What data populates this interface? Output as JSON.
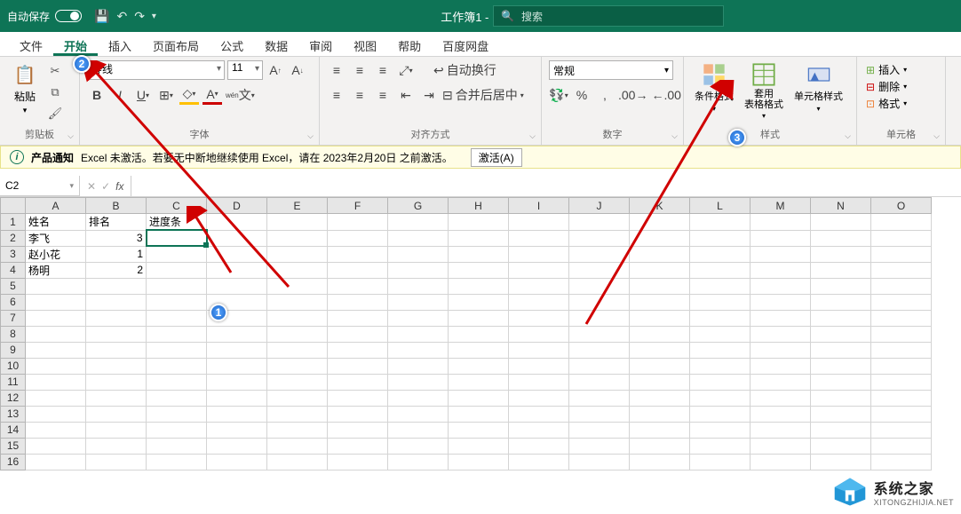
{
  "title_bar": {
    "autosave": "自动保存",
    "doc_title": "工作簿1 - Excel",
    "search_placeholder": "搜索"
  },
  "tabs": {
    "file": "文件",
    "home": "开始",
    "insert": "插入",
    "page_layout": "页面布局",
    "formulas": "公式",
    "data": "数据",
    "review": "审阅",
    "view": "视图",
    "help": "帮助",
    "baidu": "百度网盘"
  },
  "ribbon": {
    "clipboard": {
      "paste": "粘贴",
      "label": "剪贴板"
    },
    "font": {
      "name": "等线",
      "size": "11",
      "label": "字体"
    },
    "alignment": {
      "wrap": "自动换行",
      "merge": "合并后居中",
      "label": "对齐方式"
    },
    "number": {
      "format": "常规",
      "label": "数字"
    },
    "styles": {
      "conditional": "条件格式",
      "table": "套用\n表格格式",
      "cell": "单元格样式",
      "label": "样式"
    },
    "cells": {
      "insert": "插入",
      "delete": "删除",
      "format": "格式",
      "label": "单元格"
    }
  },
  "notice": {
    "title": "产品通知",
    "text": "Excel 未激活。若要无中断地继续使用 Excel，请在 2023年2月20日 之前激活。",
    "button": "激活(A)"
  },
  "namebox": {
    "ref": "C2",
    "fx": "fx"
  },
  "grid": {
    "columns": [
      "A",
      "B",
      "C",
      "D",
      "E",
      "F",
      "G",
      "H",
      "I",
      "J",
      "K",
      "L",
      "M",
      "N",
      "O"
    ],
    "rows": [
      {
        "n": 1,
        "cells": [
          "姓名",
          "排名",
          "进度条",
          "",
          "",
          "",
          "",
          "",
          "",
          "",
          "",
          "",
          "",
          "",
          ""
        ]
      },
      {
        "n": 2,
        "cells": [
          "李飞",
          "3",
          "",
          "",
          "",
          "",
          "",
          "",
          "",
          "",
          "",
          "",
          "",
          "",
          ""
        ]
      },
      {
        "n": 3,
        "cells": [
          "赵小花",
          "1",
          "",
          "",
          "",
          "",
          "",
          "",
          "",
          "",
          "",
          "",
          "",
          "",
          ""
        ]
      },
      {
        "n": 4,
        "cells": [
          "杨明",
          "2",
          "",
          "",
          "",
          "",
          "",
          "",
          "",
          "",
          "",
          "",
          "",
          "",
          ""
        ]
      },
      {
        "n": 5,
        "cells": [
          "",
          "",
          "",
          "",
          "",
          "",
          "",
          "",
          "",
          "",
          "",
          "",
          "",
          "",
          ""
        ]
      },
      {
        "n": 6,
        "cells": [
          "",
          "",
          "",
          "",
          "",
          "",
          "",
          "",
          "",
          "",
          "",
          "",
          "",
          "",
          ""
        ]
      },
      {
        "n": 7,
        "cells": [
          "",
          "",
          "",
          "",
          "",
          "",
          "",
          "",
          "",
          "",
          "",
          "",
          "",
          "",
          ""
        ]
      },
      {
        "n": 8,
        "cells": [
          "",
          "",
          "",
          "",
          "",
          "",
          "",
          "",
          "",
          "",
          "",
          "",
          "",
          "",
          ""
        ]
      },
      {
        "n": 9,
        "cells": [
          "",
          "",
          "",
          "",
          "",
          "",
          "",
          "",
          "",
          "",
          "",
          "",
          "",
          "",
          ""
        ]
      },
      {
        "n": 10,
        "cells": [
          "",
          "",
          "",
          "",
          "",
          "",
          "",
          "",
          "",
          "",
          "",
          "",
          "",
          "",
          ""
        ]
      },
      {
        "n": 11,
        "cells": [
          "",
          "",
          "",
          "",
          "",
          "",
          "",
          "",
          "",
          "",
          "",
          "",
          "",
          "",
          ""
        ]
      },
      {
        "n": 12,
        "cells": [
          "",
          "",
          "",
          "",
          "",
          "",
          "",
          "",
          "",
          "",
          "",
          "",
          "",
          "",
          ""
        ]
      },
      {
        "n": 13,
        "cells": [
          "",
          "",
          "",
          "",
          "",
          "",
          "",
          "",
          "",
          "",
          "",
          "",
          "",
          "",
          ""
        ]
      },
      {
        "n": 14,
        "cells": [
          "",
          "",
          "",
          "",
          "",
          "",
          "",
          "",
          "",
          "",
          "",
          "",
          "",
          "",
          ""
        ]
      },
      {
        "n": 15,
        "cells": [
          "",
          "",
          "",
          "",
          "",
          "",
          "",
          "",
          "",
          "",
          "",
          "",
          "",
          "",
          ""
        ]
      },
      {
        "n": 16,
        "cells": [
          "",
          "",
          "",
          "",
          "",
          "",
          "",
          "",
          "",
          "",
          "",
          "",
          "",
          "",
          ""
        ]
      }
    ],
    "active": "C2"
  },
  "callouts": {
    "c1": "1",
    "c2": "2",
    "c3": "3"
  },
  "watermark": {
    "name": "系统之家",
    "url": "XITONGZHIJIA.NET"
  }
}
